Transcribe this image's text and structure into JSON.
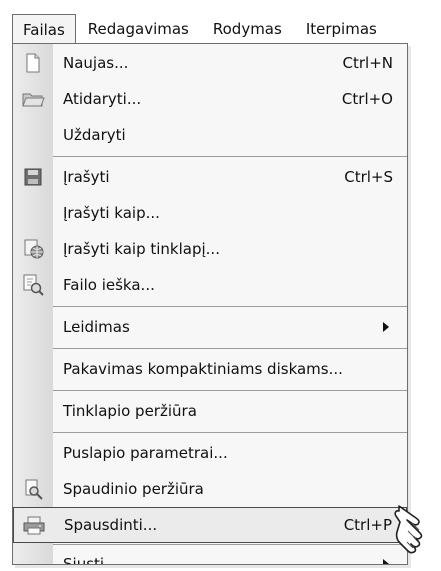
{
  "menubar": {
    "items": [
      {
        "label": "Failas",
        "active": true
      },
      {
        "label": "Redagavimas",
        "active": false
      },
      {
        "label": "Rodymas",
        "active": false
      },
      {
        "label": "Iterpimas",
        "active": false
      }
    ]
  },
  "menu": {
    "items": [
      {
        "label": "Naujas...",
        "shortcut": "Ctrl+N",
        "icon": "new-document-icon"
      },
      {
        "label": "Atidaryti...",
        "shortcut": "Ctrl+O",
        "icon": "open-folder-icon"
      },
      {
        "label": "Uždaryti",
        "shortcut": "",
        "icon": ""
      },
      {
        "label": "Įrašyti",
        "shortcut": "Ctrl+S",
        "icon": "save-disk-icon"
      },
      {
        "label": "Įrašyti kaip...",
        "shortcut": "",
        "icon": ""
      },
      {
        "label": "Įrašyti kaip tinklapį...",
        "shortcut": "",
        "icon": "web-page-icon"
      },
      {
        "label": "Failo ieška...",
        "shortcut": "",
        "icon": "file-search-icon"
      },
      {
        "label": "Leidimas",
        "shortcut": "",
        "icon": "",
        "submenu": true
      },
      {
        "label": "Pakavimas kompaktiniams diskams...",
        "shortcut": "",
        "icon": ""
      },
      {
        "label": "Tinklapio peržiūra",
        "shortcut": "",
        "icon": ""
      },
      {
        "label": "Puslapio parametrai...",
        "shortcut": "",
        "icon": ""
      },
      {
        "label": "Spaudinio peržiūra",
        "shortcut": "",
        "icon": "print-preview-icon"
      },
      {
        "label": "Spausdinti...",
        "shortcut": "Ctrl+P",
        "icon": "printer-icon",
        "selected": true
      },
      {
        "label": "Siųsti",
        "shortcut": "",
        "icon": "",
        "submenu": true
      }
    ]
  },
  "icons": {
    "pointer": "hand-pointer-icon",
    "submenu": "submenu-arrow-icon"
  }
}
